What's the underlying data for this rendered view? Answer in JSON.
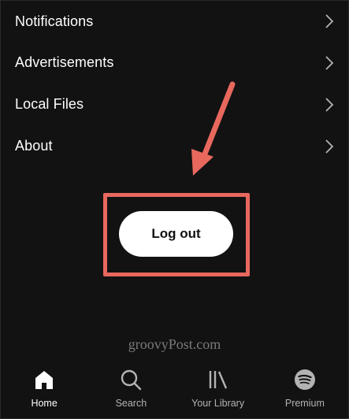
{
  "settings": {
    "items": [
      {
        "label": "Notifications"
      },
      {
        "label": "Advertisements"
      },
      {
        "label": "Local Files"
      },
      {
        "label": "About"
      }
    ]
  },
  "logout": {
    "label": "Log out"
  },
  "watermark": {
    "text": "groovyPost.com"
  },
  "annotation": {
    "arrow_color": "#e8685e",
    "box_color": "#e8685e"
  },
  "bottom_nav": {
    "tabs": [
      {
        "label": "Home",
        "icon": "home-icon",
        "active": true
      },
      {
        "label": "Search",
        "icon": "search-icon",
        "active": false
      },
      {
        "label": "Your Library",
        "icon": "library-icon",
        "active": false
      },
      {
        "label": "Premium",
        "icon": "spotify-icon",
        "active": false
      }
    ]
  },
  "colors": {
    "background": "#121212",
    "text": "#ffffff",
    "muted": "#b3b3b3"
  }
}
